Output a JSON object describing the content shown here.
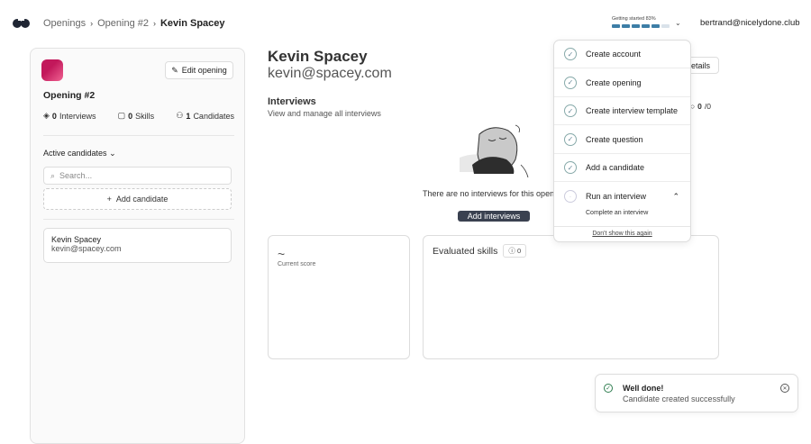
{
  "breadcrumb": [
    "Openings",
    "Opening #2",
    "Kevin Spacey"
  ],
  "getting_started": {
    "label": "Getting started 83%",
    "progress": 0.83,
    "segments_done": 5,
    "segments_total": 6
  },
  "user_email": "bertrand@nicelydone.club",
  "sidebar": {
    "edit_label": "Edit opening",
    "opening_title": "Opening #2",
    "stats": [
      {
        "value": "0",
        "label": "Interviews"
      },
      {
        "value": "0",
        "label": "Skills"
      },
      {
        "value": "1",
        "label": "Candidates"
      }
    ],
    "filter_label": "Active candidates",
    "search_placeholder": "Search...",
    "add_candidate": "Add candidate",
    "candidate": {
      "name": "Kevin Spacey",
      "email": "kevin@spacey.com"
    }
  },
  "profile": {
    "name": "Kevin Spacey",
    "email": "kevin@spacey.com"
  },
  "interviews": {
    "heading": "Interviews",
    "sub": "View and manage all interviews",
    "empty": "There are no interviews for this openi",
    "add_button": "Add interviews"
  },
  "details_button": "etails",
  "score_chip": {
    "value": "0",
    "total": "/0"
  },
  "current_score": {
    "value": "~",
    "label": "Current score"
  },
  "evaluated": {
    "title": "Evaluated skills",
    "count": "0"
  },
  "checklist": {
    "items": [
      {
        "label": "Create account",
        "done": true
      },
      {
        "label": "Create opening",
        "done": true
      },
      {
        "label": "Create interview template",
        "done": true
      },
      {
        "label": "Create question",
        "done": true
      },
      {
        "label": "Add a candidate",
        "done": true
      },
      {
        "label": "Run an interview",
        "done": false
      }
    ],
    "sub_item": "Complete an interview",
    "dont_show": "Don't show this again"
  },
  "toast": {
    "title": "Well done!",
    "message": "Candidate created successfully"
  }
}
